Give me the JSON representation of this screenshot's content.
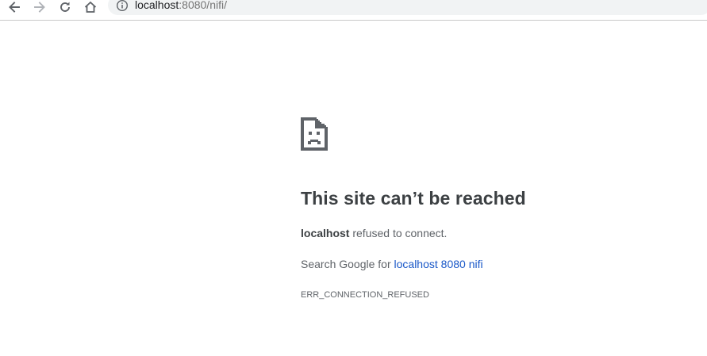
{
  "browser": {
    "url_host": "localhost",
    "url_rest": ":8080/nifi/",
    "icons": {
      "back": "arrow-left-icon",
      "forward": "arrow-right-icon",
      "reload": "reload-icon",
      "home": "home-icon",
      "site_info": "info-circle-icon"
    }
  },
  "error_page": {
    "icon": "sad-document-icon",
    "title": "This site can’t be reached",
    "host": "localhost",
    "description_suffix": " refused to connect.",
    "search_prefix": "Search Google for ",
    "search_link": "localhost 8080 nifi",
    "error_code": "ERR_CONNECTION_REFUSED"
  },
  "colors": {
    "link": "#1a58c8",
    "text": "#5f6368",
    "title": "#3c4043",
    "omnibox_bg": "#f1f3f4"
  }
}
